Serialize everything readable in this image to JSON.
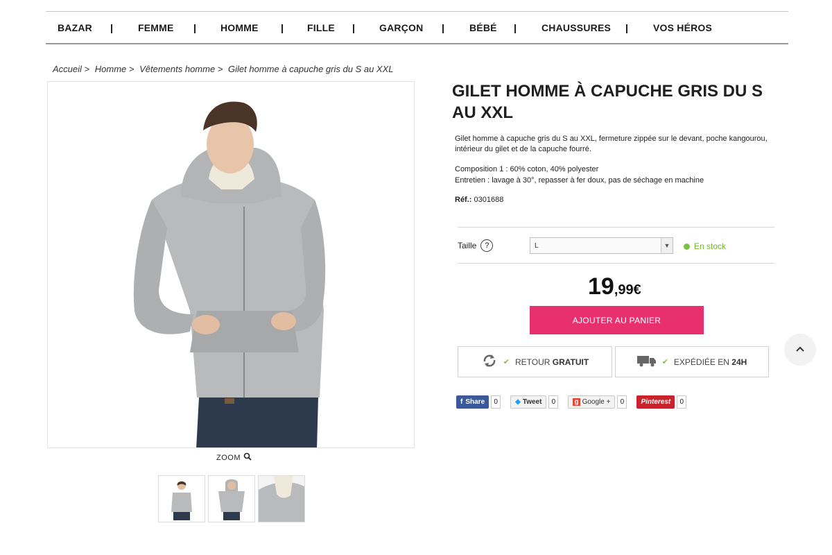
{
  "nav": {
    "items": [
      "BAZAR",
      "FEMME",
      "HOMME",
      "FILLE",
      "GARÇON",
      "BÉBÉ",
      "CHAUSSURES",
      "VOS HÉROS"
    ]
  },
  "breadcrumb": [
    "Accueil >",
    "Homme >",
    "Vêtements homme >",
    "Gilet homme à capuche gris du S au XXL"
  ],
  "zoom_label": "ZOOM",
  "product": {
    "title": "GILET HOMME À CAPUCHE GRIS DU S AU XXL",
    "description": "Gilet homme à capuche gris du S au XXL, fermeture zippée sur le devant, poche kangourou, intérieur du gilet et de la capuche fourré.",
    "composition": "Composition 1 : 60% coton, 40% polyester",
    "care": "Entretien : lavage à 30°, repasser à fer doux, pas de séchage en machine",
    "ref_label": "Réf.:",
    "ref_value": "0301688",
    "size_label": "Taille",
    "size_selected": "L",
    "stock": "En stock",
    "price_int": "19",
    "price_dec": ",99€",
    "add_to_cart": "AJOUTER AU PANIER",
    "return_label": "RETOUR",
    "return_bold": "GRATUIT",
    "ship_label": "EXPÉDIÉE EN",
    "ship_bold": "24H"
  },
  "social": {
    "facebook": {
      "label": "Share",
      "count": "0"
    },
    "twitter": {
      "label": "Tweet",
      "count": "0"
    },
    "google": {
      "label": "Google +",
      "count": "0"
    },
    "pinterest": {
      "label": "Pinterest",
      "count": "0"
    }
  },
  "colors": {
    "accent": "#e8306f",
    "stock_green": "#7bc143",
    "facebook": "#3b5998",
    "pinterest": "#c8232c"
  }
}
